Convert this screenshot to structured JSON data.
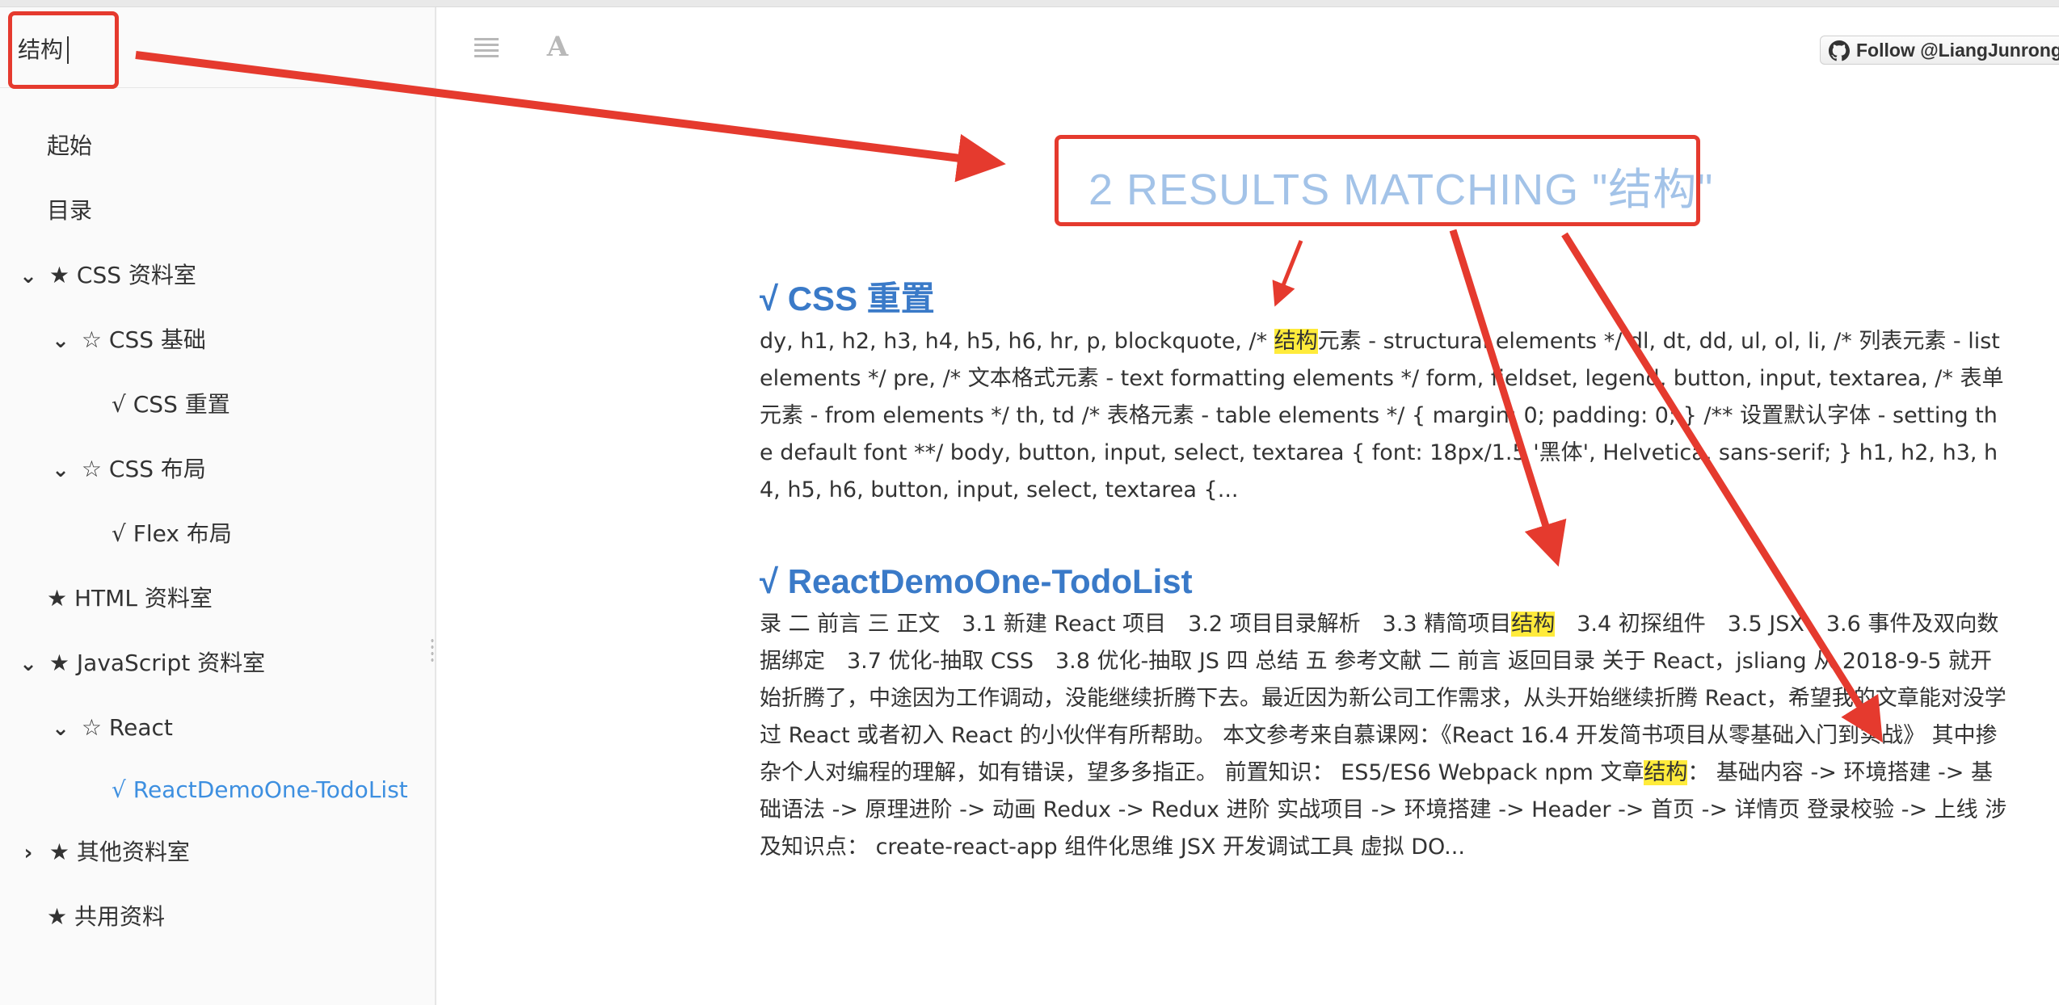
{
  "search": {
    "value": "结构",
    "placeholder": ""
  },
  "sidebar": {
    "items": [
      {
        "label": "起始",
        "chevron": ""
      },
      {
        "label": "目录",
        "chevron": ""
      },
      {
        "label": "★ CSS 资料室",
        "chevron": "⌄"
      },
      {
        "label": "☆ CSS 基础",
        "chevron": "⌄"
      },
      {
        "label": "√ CSS 重置",
        "chevron": ""
      },
      {
        "label": "☆ CSS 布局",
        "chevron": "⌄"
      },
      {
        "label": "√ Flex 布局",
        "chevron": ""
      },
      {
        "label": "★ HTML 资料室",
        "chevron": ""
      },
      {
        "label": "★ JavaScript 资料室",
        "chevron": "⌄"
      },
      {
        "label": "☆ React",
        "chevron": "⌄"
      },
      {
        "label": "√ ReactDemoOne-TodoList",
        "chevron": ""
      },
      {
        "label": "★ 其他资料室",
        "chevron": "›"
      },
      {
        "label": "★ 共用资料",
        "chevron": ""
      }
    ]
  },
  "toolbar": {
    "menu_icon": "hamburger-menu-icon",
    "font_icon": "font-settings-icon",
    "font_glyph": "A",
    "follow_label": "Follow @LiangJunrong"
  },
  "results": {
    "header": "2 RESULTS MATCHING \"结构\"",
    "items": [
      {
        "title": "√ CSS 重置",
        "snippet_before": "dy, h1, h2, h3, h4, h5, h6, hr, p, blockquote, /* ",
        "highlight": "结构",
        "snippet_after": "元素 - structural elements */ dl, dt, dd, ul, ol, li, /* 列表元素 - list elements */ pre, /* 文本格式元素 - text formatting elements */ form, fieldset, legend, button, input, textarea, /* 表单元素 - from elements */ th, td /* 表格元素 - table elements */ { margin: 0; padding: 0; } /** 设置默认字体 - setting the default font **/ body, button, input, select, textarea { font: 18px/1.5 '黑体', Helvetica, sans-serif; } h1, h2, h3, h4, h5, h6, button, input, select, textarea {..."
      },
      {
        "title": "√ ReactDemoOne-TodoList",
        "snippet_before": "录 二 前言 三 正文　3.1 新建 React 项目　3.2 项目目录解析　3.3 精简项目",
        "highlight": "结构",
        "snippet_middle": "　3.4 初探组件　3.5 JSX　3.6 事件及双向数据绑定　3.7 优化-抽取 CSS　3.8 优化-抽取 JS 四 总结 五 参考文献 二 前言 返回目录 关于 React，jsliang 从 2018-9-5 就开始折腾了，中途因为工作调动，没能继续折腾下去。最近因为新公司工作需求，从头开始继续折腾 React，希望我的文章能对没学过 React 或者初入 React 的小伙伴有所帮助。 本文参考来自慕课网：《React 16.4 开发简书项目从零基础入门到实战》 其中掺杂个人对编程的理解，如有错误，望多多指正。 前置知识： ES5/ES6 Webpack npm 文章",
        "highlight2": "结构",
        "snippet_after": "： 基础内容 -> 环境搭建 -> 基础语法 -> 原理进阶 -> 动画 Redux -> Redux 进阶 实战项目 -> 环境搭建 -> Header -> 首页 -> 详情页 登录校验 -> 上线 涉及知识点： create-react-app 组件化思维 JSX 开发调试工具 虚拟 DO..."
      }
    ]
  },
  "annotation_color": "#e53a2e",
  "highlight_color": "#ffeb3b",
  "accent_color": "#3d8fe0"
}
